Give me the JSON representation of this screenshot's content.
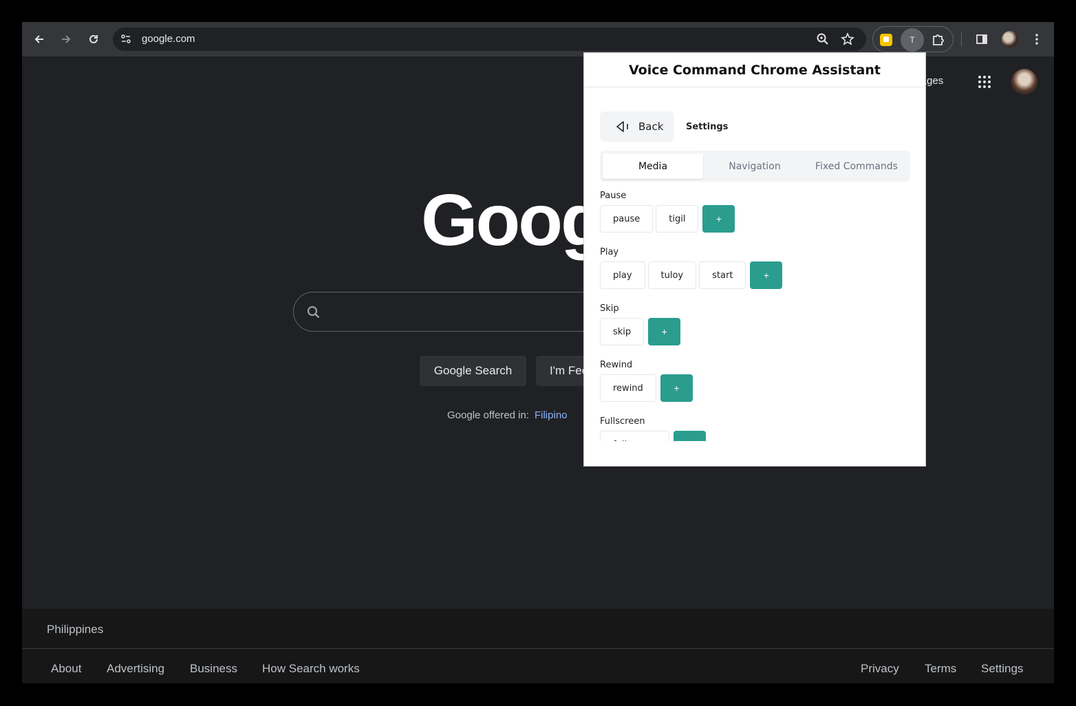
{
  "browser": {
    "url": "google.com",
    "extension_badge": "T"
  },
  "google": {
    "images_link": "Images",
    "logo_text": "Google",
    "search_button": "Google Search",
    "lucky_button": "I'm Feeling Lucky",
    "offered_label": "Google offered in:",
    "offered_lang": "Filipino",
    "footer_country": "Philippines",
    "footer_links_left": [
      "About",
      "Advertising",
      "Business",
      "How Search works"
    ],
    "footer_links_right": [
      "Privacy",
      "Terms",
      "Settings"
    ]
  },
  "popup": {
    "title": "Voice Command Chrome Assistant",
    "back_label": "Back",
    "settings_label": "Settings",
    "tabs": [
      {
        "label": "Media",
        "active": true
      },
      {
        "label": "Navigation",
        "active": false
      },
      {
        "label": "Fixed Commands",
        "active": false
      }
    ],
    "add_label": "+",
    "groups": [
      {
        "label": "Pause",
        "commands": [
          "pause",
          "tigil"
        ]
      },
      {
        "label": "Play",
        "commands": [
          "play",
          "tuloy",
          "start"
        ]
      },
      {
        "label": "Skip",
        "commands": [
          "skip"
        ]
      },
      {
        "label": "Rewind",
        "commands": [
          "rewind"
        ]
      },
      {
        "label": "Fullscreen",
        "commands": [
          "fullscreen"
        ]
      }
    ]
  },
  "colors": {
    "accent": "#2a9d8f",
    "page_bg": "#202124",
    "toolbar_bg": "#35363a",
    "link": "#8ab4f8"
  }
}
